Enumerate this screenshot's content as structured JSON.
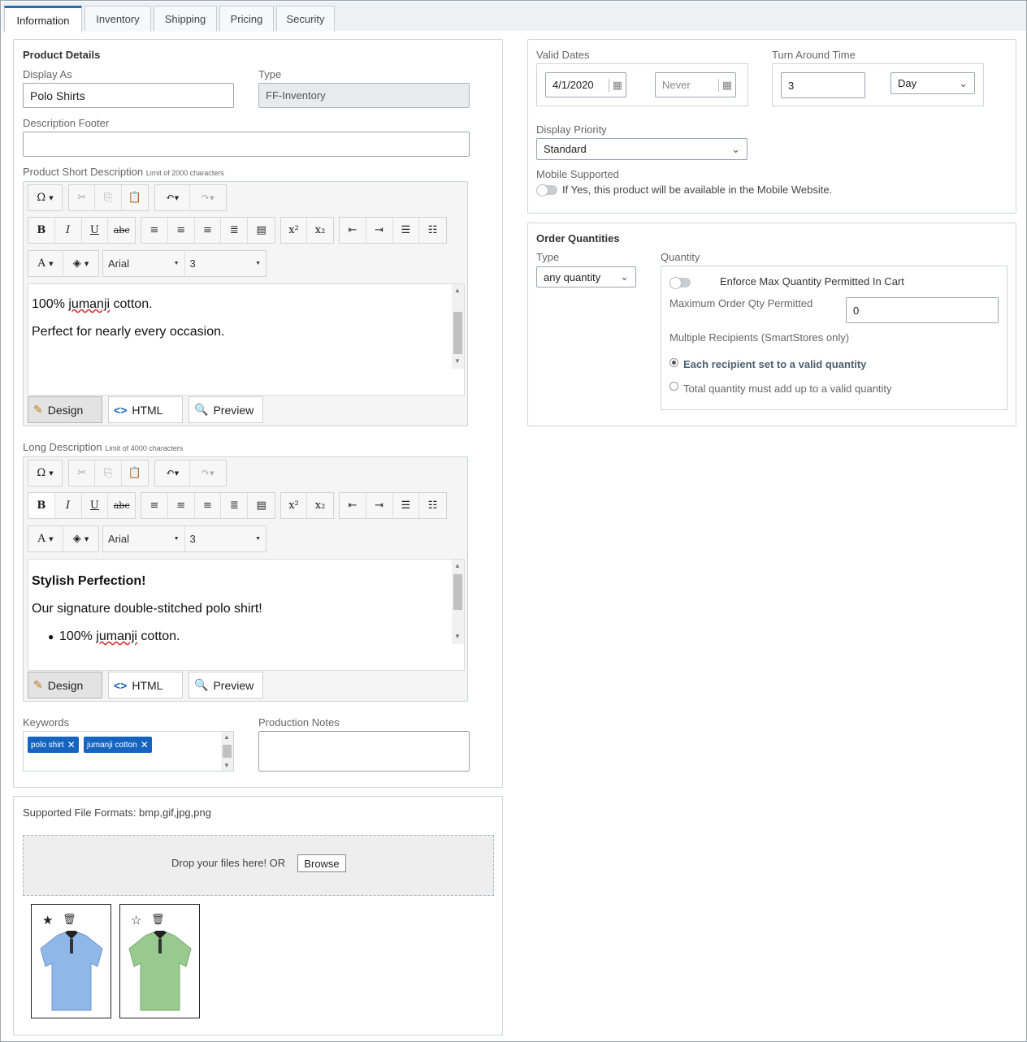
{
  "tabs": [
    {
      "label": "Information"
    },
    {
      "label": "Inventory"
    },
    {
      "label": "Shipping"
    },
    {
      "label": "Pricing"
    },
    {
      "label": "Security"
    }
  ],
  "product_details": {
    "heading": "Product Details",
    "display_as_label": "Display As",
    "display_as_value": "Polo Shirts",
    "type_label": "Type",
    "type_value": "FF-Inventory",
    "description_footer_label": "Description Footer",
    "description_footer_value": ""
  },
  "short_description": {
    "label": "Product Short Description",
    "limit_note": "Limit of 2000 characters",
    "font_name": "Arial",
    "font_size": "3",
    "content": {
      "line1_pre": "100% ",
      "line1_word": "jumanji",
      "line1_post": " cotton.",
      "line2": "Perfect for nearly every occasion."
    },
    "modes": {
      "design": "Design",
      "html": "HTML",
      "preview": "Preview"
    }
  },
  "long_description": {
    "label": "Long Description",
    "limit_note": "Limit of 4000 characters",
    "font_name": "Arial",
    "font_size": "3",
    "content": {
      "heading": "Stylish Perfection!",
      "line": "Our signature double-stitched polo shirt!",
      "bullet_pre": "100% ",
      "bullet_word": "jumanji",
      "bullet_post": " cotton."
    },
    "modes": {
      "design": "Design",
      "html": "HTML",
      "preview": "Preview"
    }
  },
  "toolbar": {
    "omega": "Ω",
    "bold": "B",
    "italic": "I",
    "underline": "U",
    "strike": "abc",
    "superscript": "x²",
    "subscript": "x₂",
    "fore_color": "A"
  },
  "keywords": {
    "label": "Keywords",
    "chips": [
      "polo shirt",
      "jumanji cotton"
    ]
  },
  "production_notes": {
    "label": "Production Notes",
    "value": ""
  },
  "files": {
    "supported_formats": "Supported File Formats: bmp,gif,jpg,png",
    "drop_text": "Drop your files here! OR",
    "browse_label": "Browse",
    "images": [
      {
        "color": "#8fb8e8",
        "starred": true
      },
      {
        "color": "#98c98f",
        "starred": false
      }
    ]
  },
  "valid_dates": {
    "label": "Valid Dates",
    "start": "4/1/2020",
    "end_placeholder": "Never"
  },
  "turn_around": {
    "label": "Turn Around Time",
    "value": "3",
    "unit": "Day"
  },
  "display_priority": {
    "label": "Display Priority",
    "value": "Standard"
  },
  "mobile": {
    "label": "Mobile Supported",
    "note": "If Yes, this product will be available in the Mobile Website.",
    "enabled": false
  },
  "order_quantities": {
    "heading": "Order Quantities",
    "type_label": "Type",
    "type_value": "any quantity",
    "quantity_label": "Quantity",
    "enforce_label": "Enforce Max Quantity Permitted In Cart",
    "max_label": "Maximum Order Qty Permitted",
    "max_value": "0",
    "multi_label": "Multiple Recipients (SmartStores only)",
    "option1": "Each recipient set to a valid quantity",
    "option2": "Total quantity must add up to a valid quantity"
  }
}
